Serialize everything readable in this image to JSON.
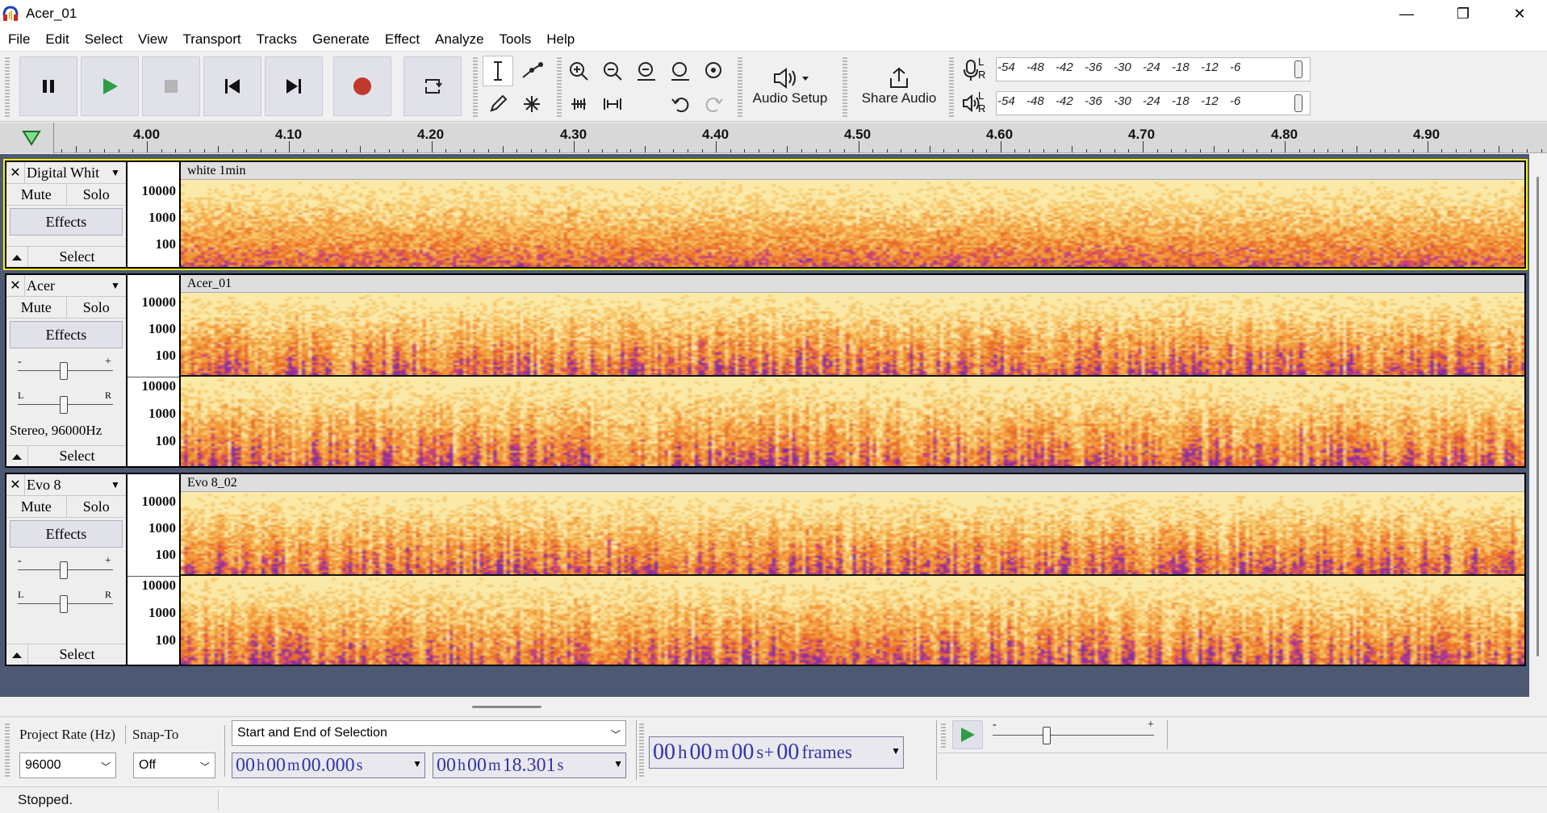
{
  "window": {
    "title": "Acer_01",
    "minimize": "—",
    "maximize": "❐",
    "close": "✕"
  },
  "menu": [
    "File",
    "Edit",
    "Select",
    "View",
    "Transport",
    "Tracks",
    "Generate",
    "Effect",
    "Analyze",
    "Tools",
    "Help"
  ],
  "toolbar": {
    "audio_setup": "Audio Setup",
    "share_audio": "Share Audio",
    "meter_scale": [
      "-54",
      "-48",
      "-42",
      "-36",
      "-30",
      "-24",
      "-18",
      "-12",
      "-6"
    ],
    "meter_channels": [
      "L",
      "R"
    ]
  },
  "ruler": {
    "labels": [
      "4.00",
      "4.10",
      "4.20",
      "4.30",
      "4.40",
      "4.50",
      "4.60",
      "4.70",
      "4.80",
      "4.90"
    ]
  },
  "tracks": [
    {
      "name": "Digital Whit",
      "clip": "white 1min",
      "mute": "Mute",
      "solo": "Solo",
      "effects": "Effects",
      "select": "Select",
      "info": "",
      "axis": [
        "10000",
        "1000",
        "100"
      ]
    },
    {
      "name": "Acer",
      "clip": "Acer_01",
      "mute": "Mute",
      "solo": "Solo",
      "effects": "Effects",
      "select": "Select",
      "info": "Stereo, 96000Hz",
      "axis": [
        "10000",
        "1000",
        "100"
      ]
    },
    {
      "name": "Evo 8",
      "clip": "Evo 8_02",
      "mute": "Mute",
      "solo": "Solo",
      "effects": "Effects",
      "select": "Select",
      "info": "",
      "axis": [
        "10000",
        "1000",
        "100"
      ]
    }
  ],
  "slider_marks": {
    "minus": "-",
    "plus": "+",
    "left": "L",
    "right": "R"
  },
  "selection_bar": {
    "project_rate_label": "Project Rate (Hz)",
    "project_rate_value": "96000",
    "snap_to_label": "Snap-To",
    "snap_to_value": "Off",
    "selection_mode": "Start and End of Selection",
    "start_time": {
      "h": "00",
      "m": "00",
      "s": "00.000"
    },
    "end_time": {
      "h": "00",
      "m": "00",
      "s": "18.301"
    },
    "position": {
      "h": "00",
      "m": "00",
      "s": "00",
      "frames": "00"
    },
    "unit_h": "h",
    "unit_m": "m",
    "unit_s": "s",
    "unit_s_plus": "s+",
    "unit_frames": "frames"
  },
  "status": "Stopped.",
  "colors": {
    "track_bg": "#4d5973",
    "selected_outline": "#f5f50a",
    "record": "#c0392b",
    "play": "#2e9e44",
    "timetext": "#3535a8"
  }
}
